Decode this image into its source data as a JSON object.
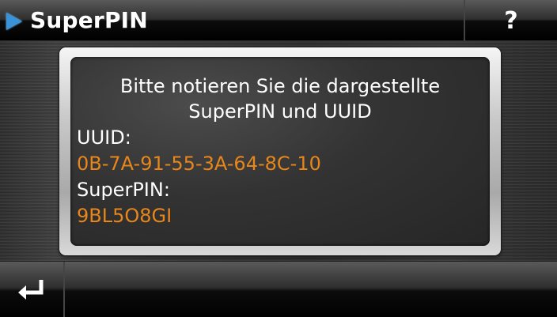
{
  "header": {
    "title": "SuperPIN",
    "help_label": "?"
  },
  "dialog": {
    "instruction_line1": "Bitte notieren Sie die dargestellte",
    "instruction_line2": "SuperPIN und UUID",
    "uuid_label": "UUID:",
    "uuid_value": "0B-7A-91-55-3A-64-8C-10",
    "superpin_label": "SuperPIN:",
    "superpin_value": "9BL5O8GI"
  },
  "footer": {
    "back_icon": "return-arrow-icon"
  },
  "colors": {
    "accent_blue": "#3a93d8",
    "value_orange": "#e8861a",
    "text_white": "#ffffff"
  }
}
